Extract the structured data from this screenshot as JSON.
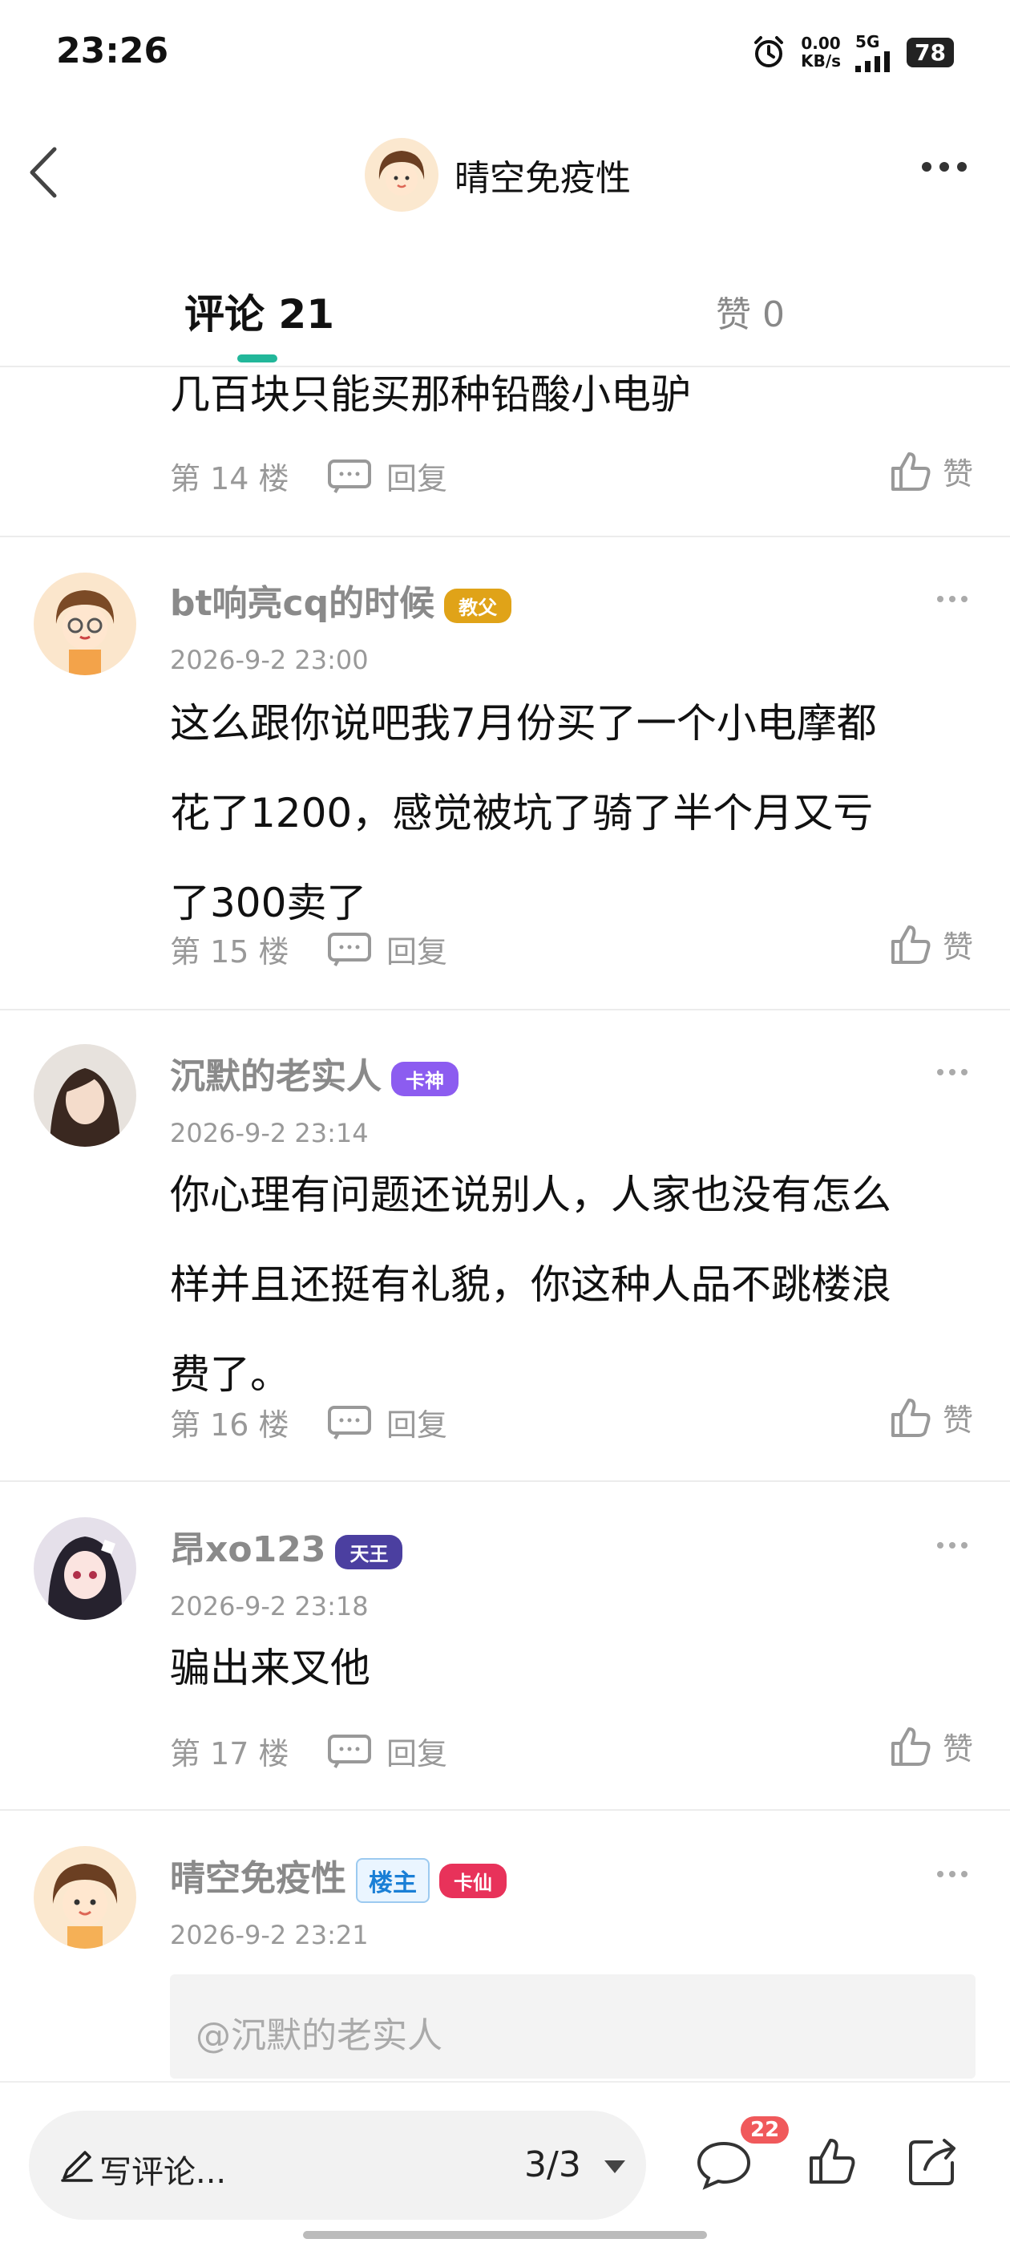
{
  "status": {
    "time": "23:26",
    "speed_value": "0.00",
    "speed_unit": "KB/s",
    "network": "5G",
    "battery": "78",
    "alarm_icon": "alarm-clock-icon"
  },
  "header": {
    "title": "晴空免疫性",
    "back_icon": "chevron-left-icon",
    "more_icon": "more-horizontal-icon"
  },
  "tabs": {
    "comments_label": "评论 21",
    "likes_label": "赞 0"
  },
  "comments": [
    {
      "content_lines": [
        "几百块只能买那种铅酸小电驴"
      ],
      "floor": "第 14 楼",
      "reply": "回复",
      "like": "赞"
    },
    {
      "name": "bt响亮cq的时候",
      "badge": "教父",
      "badge_color": "#e0a318",
      "time": "2026-9-2 23:00",
      "content_lines": [
        "这么跟你说吧我7月份买了一个小电摩都",
        "花了1200，感觉被坑了骑了半个月又亏",
        "了300卖了"
      ],
      "floor": "第 15 楼",
      "reply": "回复",
      "like": "赞"
    },
    {
      "name": "沉默的老实人",
      "badge": "卡神",
      "badge_color": "#8c5cf0",
      "time": "2026-9-2 23:14",
      "content_lines": [
        "你心理有问题还说别人，人家也没有怎么",
        "样并且还挺有礼貌，你这种人品不跳楼浪",
        "费了。"
      ],
      "floor": "第 16 楼",
      "reply": "回复",
      "like": "赞"
    },
    {
      "name": "昂xo123",
      "badge": "天王",
      "badge_color": "#4b3fa0",
      "time": "2026-9-2 23:18",
      "content_lines": [
        "骗出来叉他"
      ],
      "floor": "第 17 楼",
      "reply": "回复",
      "like": "赞"
    },
    {
      "name": "晴空免疫性",
      "owner_badge": "楼主",
      "badge": "卡仙",
      "badge_color": "#e8325a",
      "time": "2026-9-2 23:21",
      "quote": "@沉默的老实人"
    }
  ],
  "bottom_bar": {
    "write_label": "写评论...",
    "page": "3/3",
    "comment_count": "22"
  }
}
